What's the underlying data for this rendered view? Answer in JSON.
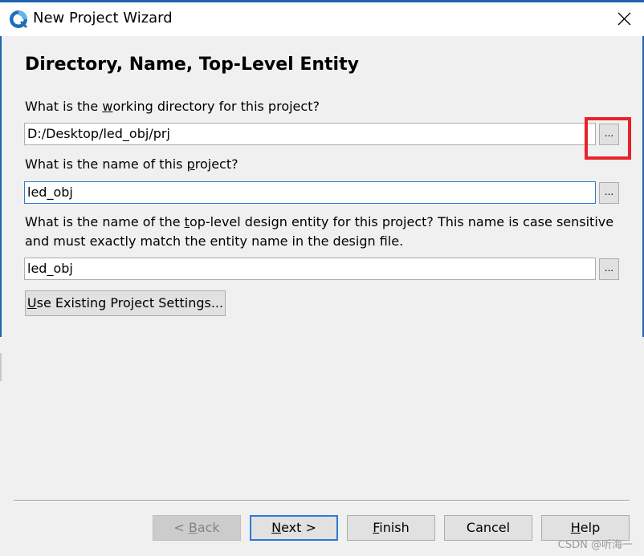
{
  "window": {
    "title": "New Project Wizard",
    "accent_color": "#1f64b0"
  },
  "page": {
    "heading": "Directory, Name, Top-Level Entity"
  },
  "working_dir": {
    "label_pre": "What is the ",
    "label_mnemonic": "w",
    "label_post": "orking directory for this project?",
    "value": "D:/Desktop/led_obj/prj",
    "browse_label": "..."
  },
  "project_name": {
    "label_pre": "What is the name of this ",
    "label_mnemonic": "p",
    "label_post": "roject?",
    "value": "led_obj",
    "browse_label": "..."
  },
  "top_entity": {
    "label_line1_pre": "What is the name of the ",
    "label_line1_mnemonic": "t",
    "label_line1_post": "op-level design entity for this project? This name is case sensitive",
    "label_line2": "and must exactly match the entity name in the design file.",
    "value": "led_obj",
    "browse_label": "..."
  },
  "use_existing": {
    "mnemonic": "U",
    "rest": "se Existing Project Settings..."
  },
  "footer": {
    "back": {
      "pre": "< ",
      "mnemonic": "B",
      "rest": "ack"
    },
    "next": {
      "mnemonic": "N",
      "rest": "ext >"
    },
    "finish": {
      "mnemonic": "F",
      "rest": "inish"
    },
    "cancel": "Cancel",
    "help": {
      "mnemonic": "H",
      "rest": "elp"
    }
  },
  "watermark": "CSDN @听海一",
  "highlight_color": "#e8222a"
}
